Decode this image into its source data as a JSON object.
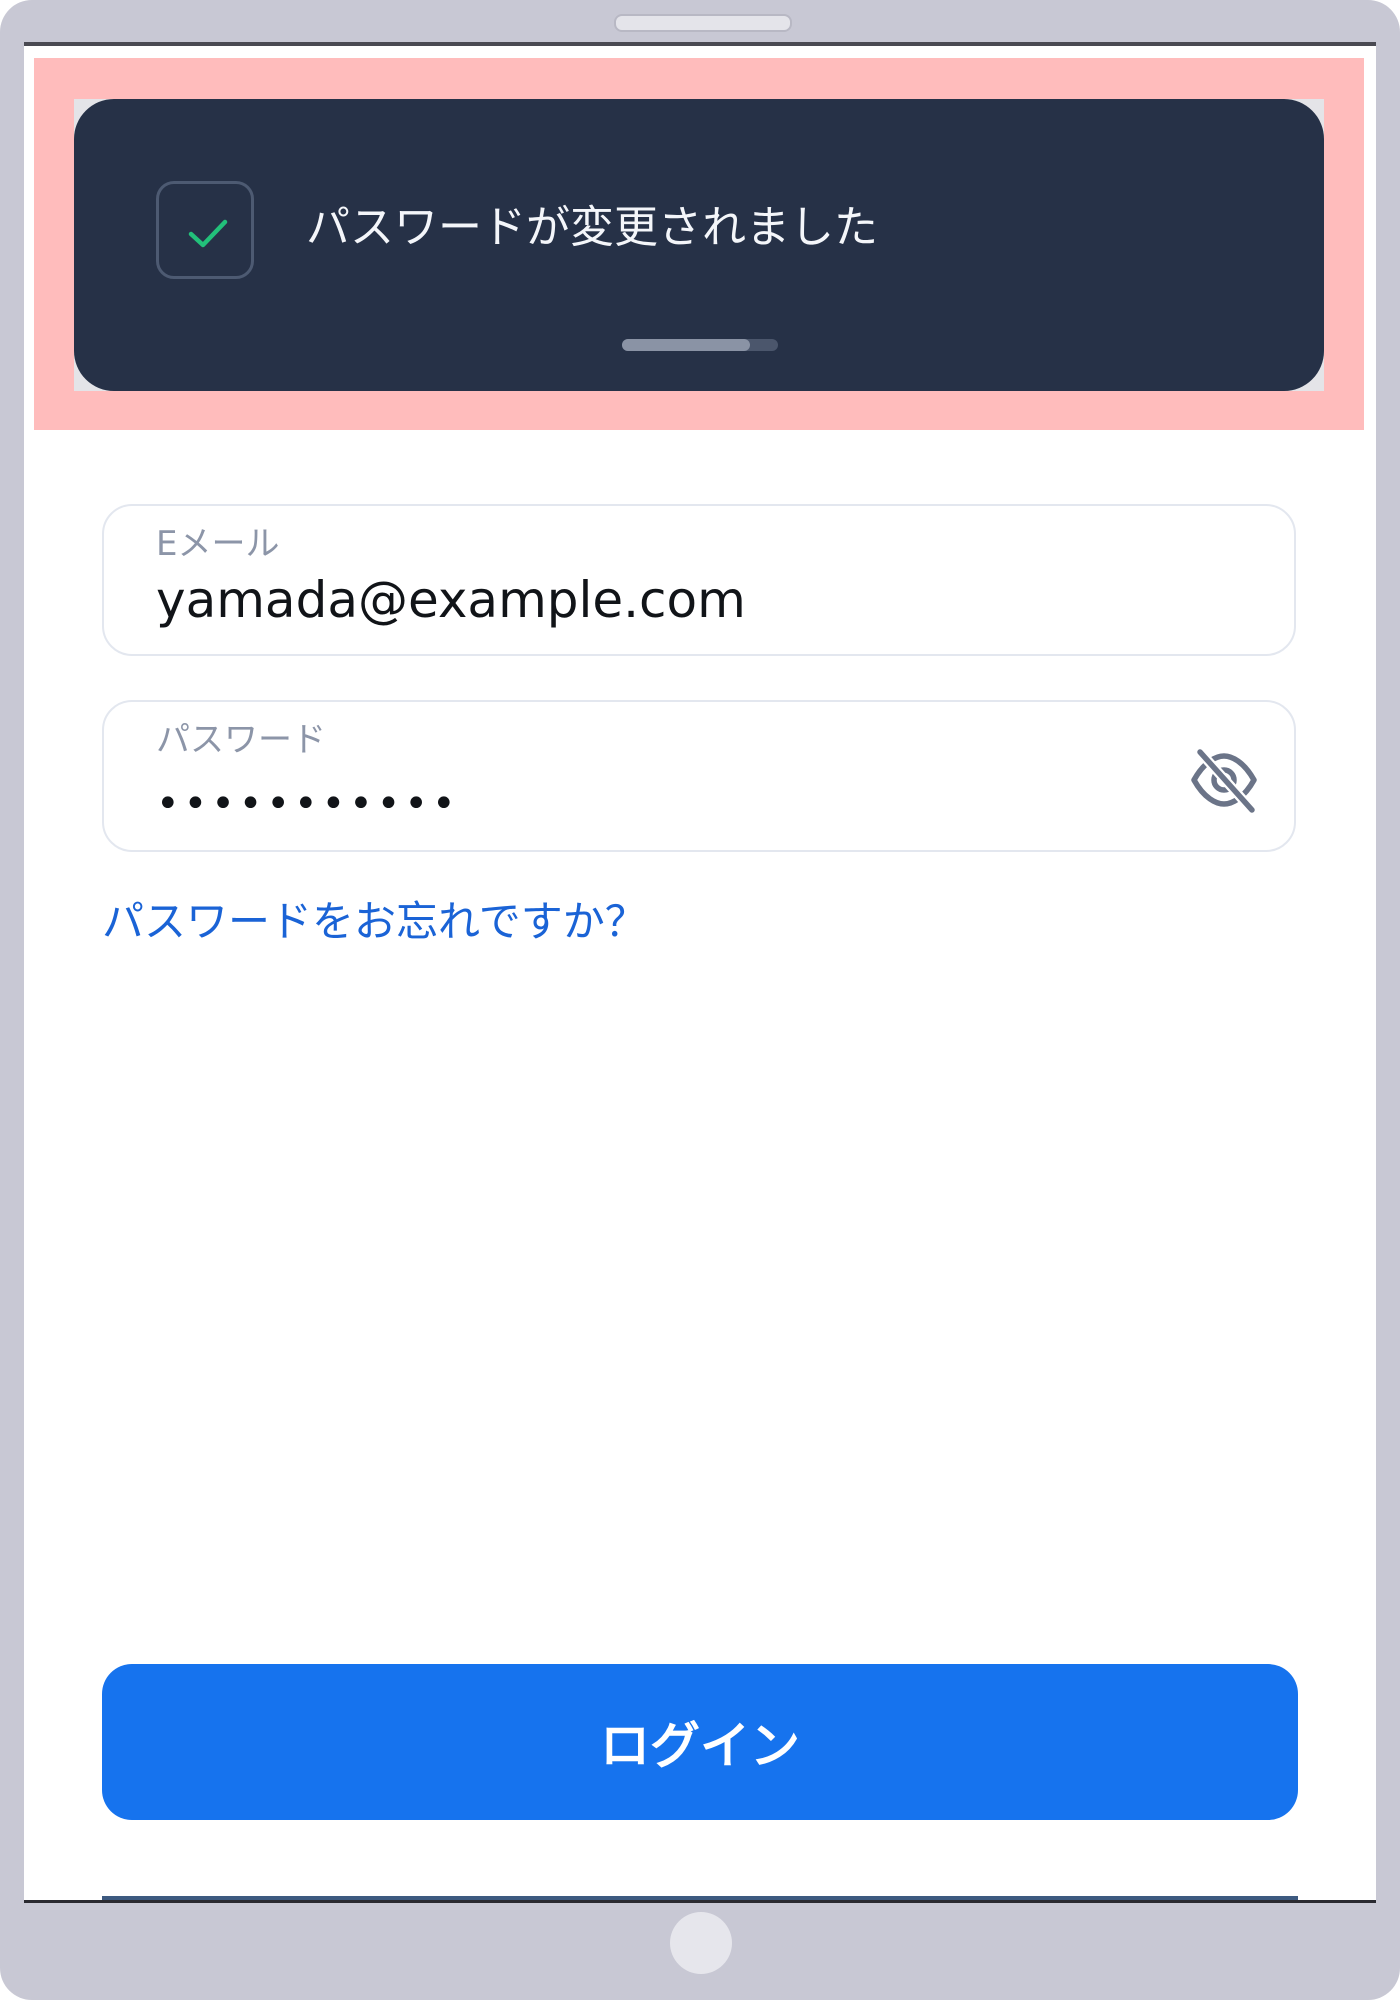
{
  "toast": {
    "message": "パスワードが変更されました",
    "icon": "check-icon",
    "progress_fraction": 0.82,
    "colors": {
      "background": "#263147",
      "check": "#22c07a",
      "highlight": "#ffbcbc"
    }
  },
  "email_field": {
    "label": "Eメール",
    "value": "yamada@example.com"
  },
  "password_field": {
    "label": "パスワード",
    "masked_value": "•••••••••••",
    "toggle_icon": "eye-off-icon"
  },
  "forgot_password_link": "パスワードをお忘れですか？",
  "login_button": {
    "label": "ログイン",
    "color": "#1673ee"
  }
}
